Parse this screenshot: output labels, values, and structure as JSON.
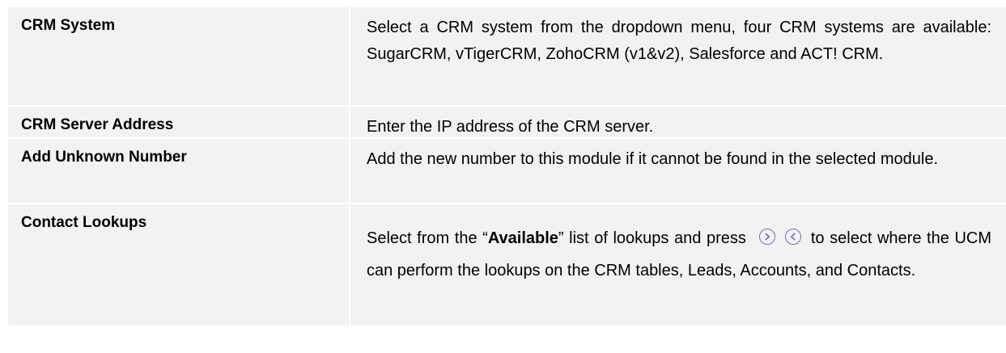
{
  "rows": [
    {
      "label": "CRM System",
      "description": "Select a CRM system from the dropdown menu, four CRM systems are available: SugarCRM, vTigerCRM, ZohoCRM (v1&v2), Salesforce and ACT! CRM."
    },
    {
      "label": "CRM Server Address",
      "description": "Enter the IP address of the CRM server."
    },
    {
      "label": "Add Unknown Number",
      "description": "Add the new number to this module if it cannot be found in the selected module."
    },
    {
      "label": "Contact Lookups",
      "description_before": "Select from the “",
      "description_bold": "Available",
      "description_mid": "” list of lookups and press",
      "description_after": "to select where the UCM can perform the lookups on the CRM tables, Leads, Accounts, and Contacts.",
      "icons": [
        "move-right-icon",
        "move-left-icon"
      ]
    }
  ],
  "colors": {
    "cell_background": "#f2f2f2",
    "icon_stroke": "#8b62b6"
  }
}
